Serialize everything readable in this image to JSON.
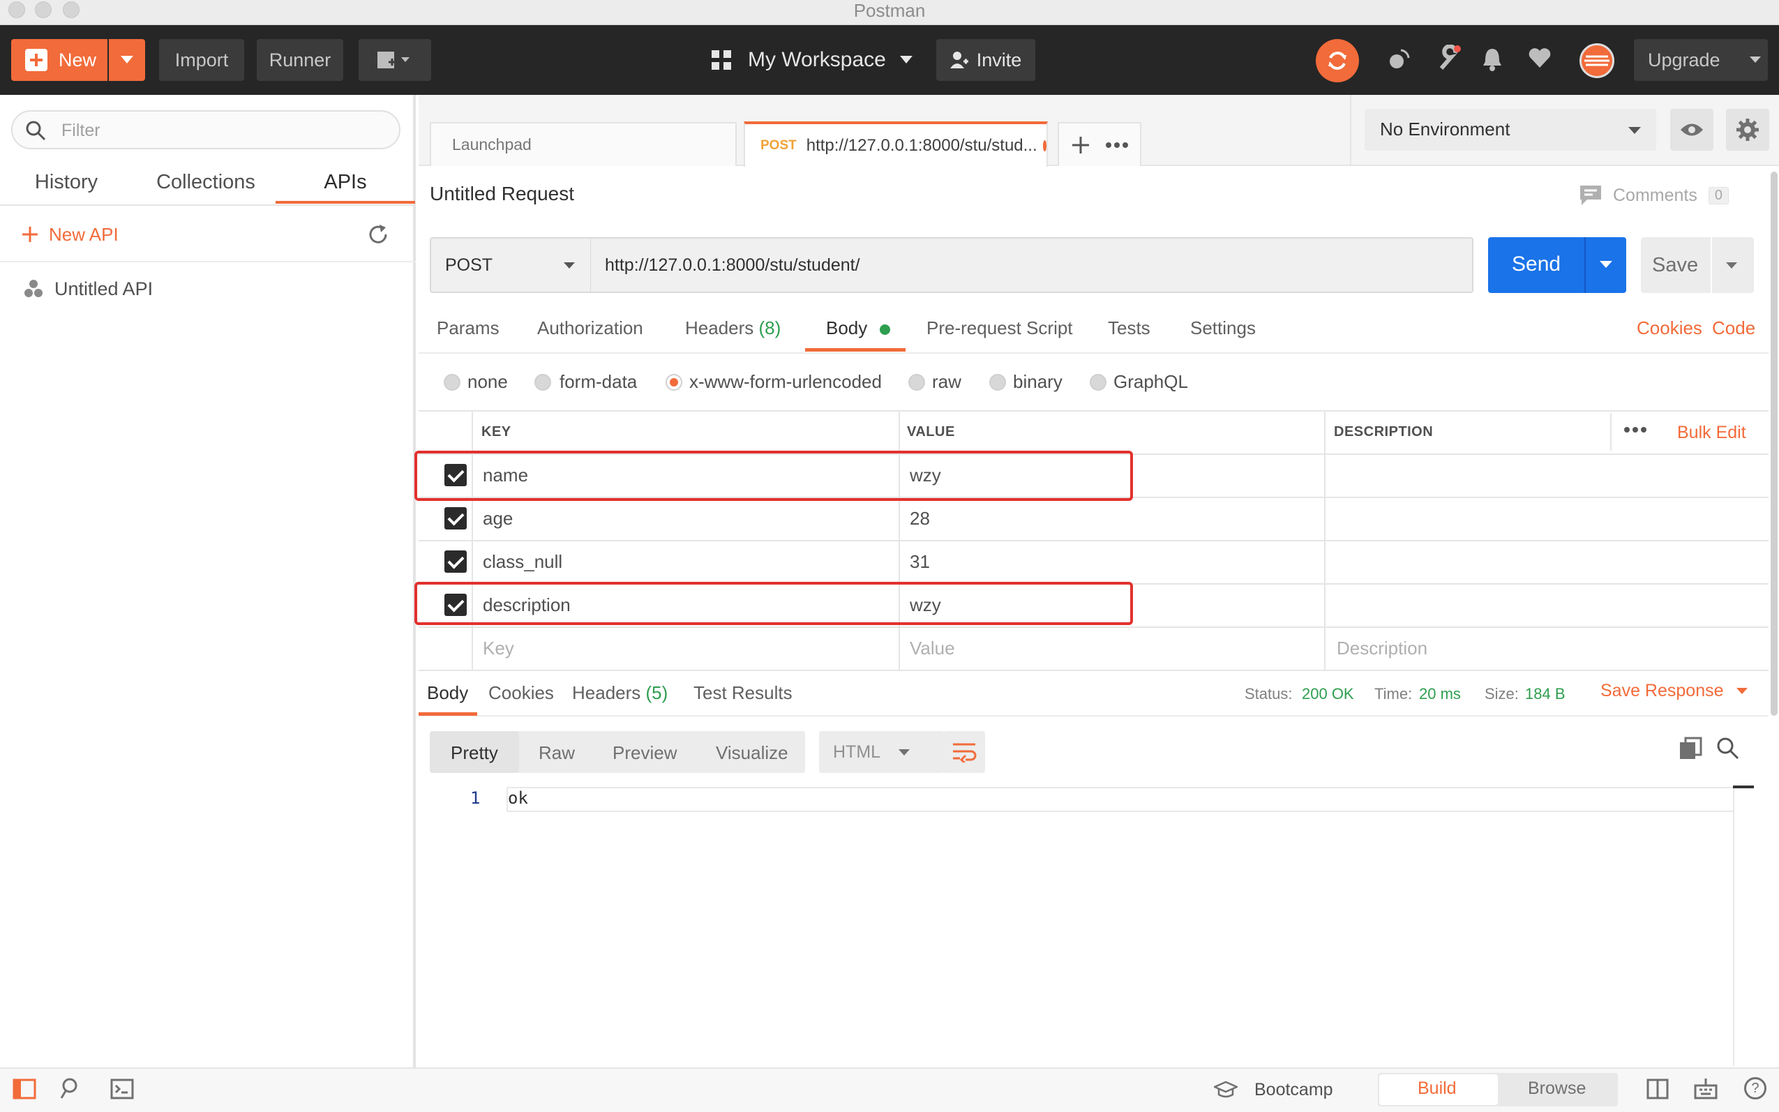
{
  "window": {
    "title": "Postman"
  },
  "header": {
    "new_label": "New",
    "import_label": "Import",
    "runner_label": "Runner",
    "workspace_label": "My Workspace",
    "invite_label": "Invite",
    "upgrade_label": "Upgrade"
  },
  "sidebar": {
    "filter_placeholder": "Filter",
    "tabs": [
      {
        "label": "History"
      },
      {
        "label": "Collections"
      },
      {
        "label": "APIs",
        "active": true
      }
    ],
    "new_api_label": "New API",
    "items": [
      {
        "label": "Untitled API"
      }
    ]
  },
  "request_tabs": [
    {
      "label": "Launchpad"
    },
    {
      "method": "POST",
      "label": "http://127.0.0.1:8000/stu/stud...",
      "active": true,
      "unsaved": true
    }
  ],
  "environment": {
    "selected": "No Environment"
  },
  "request": {
    "title": "Untitled Request",
    "comments_label": "Comments",
    "comments_count": "0",
    "method": "POST",
    "url": "http://127.0.0.1:8000/stu/student/",
    "send_label": "Send",
    "save_label": "Save",
    "tabs": [
      {
        "label": "Params"
      },
      {
        "label": "Authorization"
      },
      {
        "label": "Headers",
        "count": "(8)"
      },
      {
        "label": "Body",
        "active": true
      },
      {
        "label": "Pre-request Script"
      },
      {
        "label": "Tests"
      },
      {
        "label": "Settings"
      }
    ],
    "links": {
      "cookies": "Cookies",
      "code": "Code"
    },
    "body_modes": [
      {
        "label": "none"
      },
      {
        "label": "form-data"
      },
      {
        "label": "x-www-form-urlencoded",
        "selected": true
      },
      {
        "label": "raw"
      },
      {
        "label": "binary"
      },
      {
        "label": "GraphQL"
      }
    ],
    "table": {
      "headers": {
        "key": "KEY",
        "value": "VALUE",
        "description": "DESCRIPTION"
      },
      "bulk_edit_label": "Bulk Edit",
      "rows": [
        {
          "checked": true,
          "key": "name",
          "value": "wzy",
          "highlighted": true
        },
        {
          "checked": true,
          "key": "age",
          "value": "28"
        },
        {
          "checked": true,
          "key": "class_null",
          "value": "31"
        },
        {
          "checked": true,
          "key": "description",
          "value": "wzy",
          "highlighted": true
        }
      ],
      "placeholders": {
        "key": "Key",
        "value": "Value",
        "description": "Description"
      }
    }
  },
  "response": {
    "tabs": [
      {
        "label": "Body",
        "active": true
      },
      {
        "label": "Cookies"
      },
      {
        "label": "Headers",
        "count": "(5)"
      },
      {
        "label": "Test Results"
      }
    ],
    "status_label": "Status:",
    "status_value": "200 OK",
    "time_label": "Time:",
    "time_value": "20 ms",
    "size_label": "Size:",
    "size_value": "184 B",
    "save_response_label": "Save Response",
    "view_modes": [
      {
        "label": "Pretty",
        "active": true
      },
      {
        "label": "Raw"
      },
      {
        "label": "Preview"
      },
      {
        "label": "Visualize"
      }
    ],
    "format": "HTML",
    "lines": [
      {
        "num": "1",
        "text": "ok"
      }
    ]
  },
  "footer": {
    "bootcamp_label": "Bootcamp",
    "build_label": "Build",
    "browse_label": "Browse"
  },
  "colors": {
    "accent": "#f26b3a",
    "send_blue": "#1a73e8",
    "status_green": "#2e9e4f",
    "highlight_red": "#e2312e",
    "header_bg": "#262626"
  }
}
